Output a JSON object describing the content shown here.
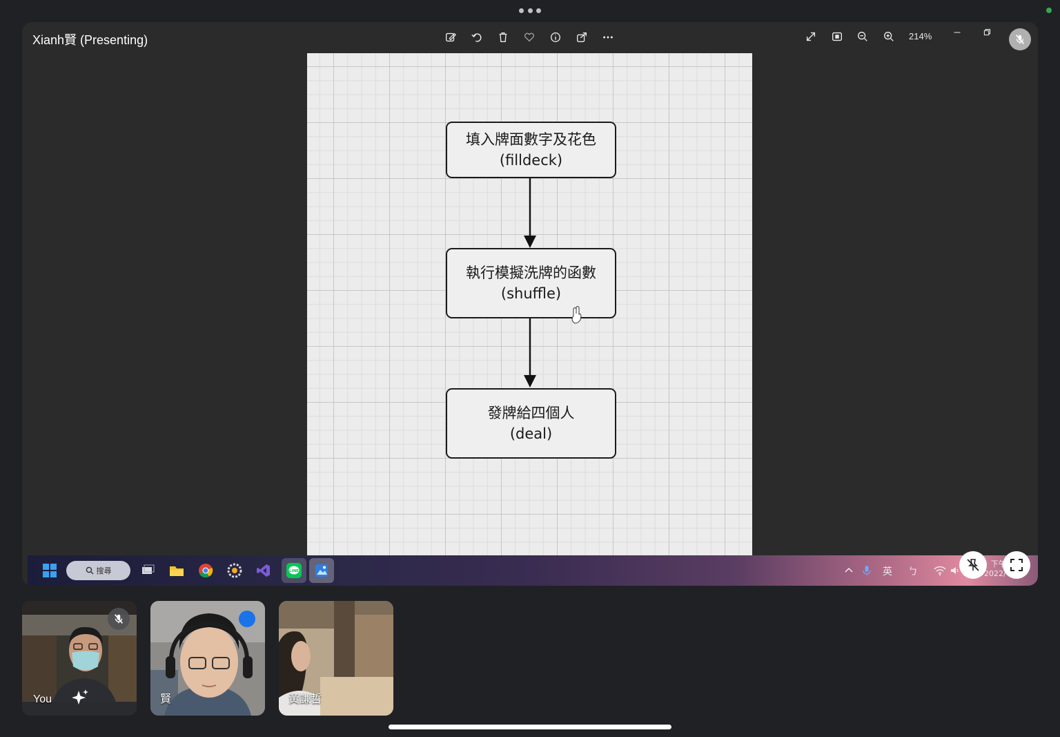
{
  "presenter_label": "Xianh賢 (Presenting)",
  "viewer": {
    "left_icons": [
      "edit-icon",
      "rotate-icon",
      "delete-icon",
      "favorite-icon",
      "info-icon",
      "share-icon",
      "more-icon"
    ],
    "right_icons": [
      "expand-icon",
      "fit-icon",
      "zoom-out-icon",
      "zoom-in-icon"
    ],
    "zoom": "214%",
    "window_controls": [
      "minimize-icon",
      "restore-icon"
    ]
  },
  "flowchart": {
    "nodes": [
      {
        "line1": "填入牌面數字及花色",
        "line2": "(filldeck)"
      },
      {
        "line1": "執行模擬洗牌的函數",
        "line2": "(shuffle)"
      },
      {
        "line1": "發牌給四個人",
        "line2": "(deal)"
      }
    ]
  },
  "taskbar": {
    "search_label": "搜尋",
    "tray_ime": "英",
    "tray_bopomofo": "ㄅ",
    "clock_line1": "下午",
    "clock_line2": "2022/"
  },
  "participants": [
    {
      "name": "You",
      "muted": true
    },
    {
      "name": "賢",
      "muted": false
    },
    {
      "name": "黃謙哲",
      "muted": false
    }
  ],
  "colors": {
    "meet_bg": "#202124",
    "green": "#34a853",
    "accent_blue": "#1a73e8"
  }
}
